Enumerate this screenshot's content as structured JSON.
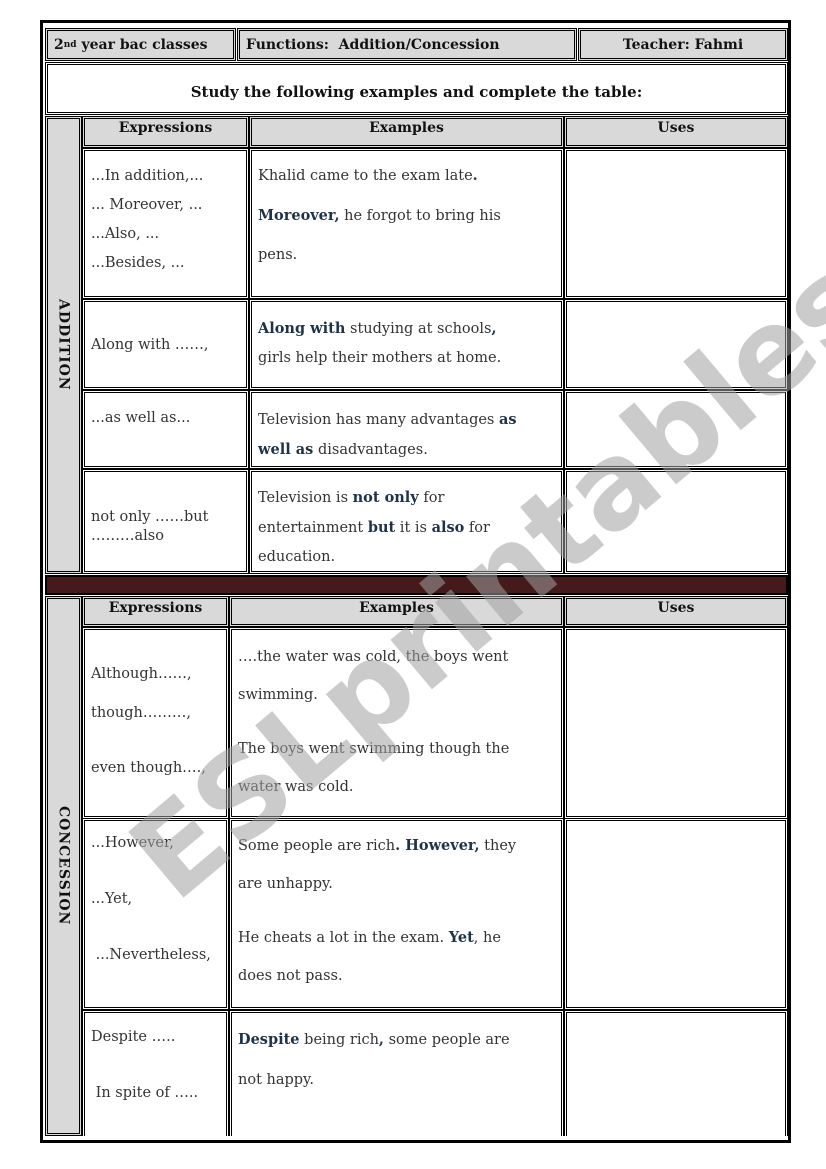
{
  "header": {
    "class_label_prefix": "2",
    "class_label_sup": "nd",
    "class_label_rest": " year bac classes",
    "functions_label": "Functions:  Addition/Concession",
    "teacher_label": "Teacher: Fahmi"
  },
  "instruction": "Study the following examples and complete the table:",
  "columns": {
    "expressions": "Expressions",
    "examples": "Examples",
    "uses": "Uses"
  },
  "addition": {
    "section_label": "ADDITION",
    "rows": [
      {
        "expressions": [
          "...In addition,...",
          "... Moreover, ...",
          "...Also, ...",
          "...Besides, ..."
        ],
        "example": [
          [
            {
              "t": "Khalid came to the exam late",
              "b": false
            },
            {
              "t": ".",
              "b": true
            }
          ],
          [
            {
              "t": "Moreover,",
              "b": true
            },
            {
              "t": " he forgot to bring his",
              "b": false
            }
          ],
          [
            {
              "t": "pens.",
              "b": false
            }
          ]
        ],
        "uses": ""
      },
      {
        "expressions": [
          "Along with ……,"
        ],
        "example": [
          [
            {
              "t": "Along with",
              "b": true
            },
            {
              "t": " studying at schools",
              "b": false
            },
            {
              "t": ",",
              "b": true
            }
          ],
          [
            {
              "t": "girls help their mothers at home.",
              "b": false
            }
          ]
        ],
        "uses": ""
      },
      {
        "expressions": [
          "...as well as..."
        ],
        "example": [
          [
            {
              "t": "Television has many advantages ",
              "b": false
            },
            {
              "t": "as",
              "b": true
            }
          ],
          [
            {
              "t": "well as",
              "b": true
            },
            {
              "t": " disadvantages.",
              "b": false
            }
          ]
        ],
        "uses": ""
      },
      {
        "expressions": [
          "not only ……but",
          "………also"
        ],
        "example": [
          [
            {
              "t": "Television is ",
              "b": false
            },
            {
              "t": "not only",
              "b": true
            },
            {
              "t": " for",
              "b": false
            }
          ],
          [
            {
              "t": "entertainment ",
              "b": false
            },
            {
              "t": "but",
              "b": true
            },
            {
              "t": " it is ",
              "b": false
            },
            {
              "t": "also",
              "b": true
            },
            {
              "t": " for",
              "b": false
            }
          ],
          [
            {
              "t": "education.",
              "b": false
            }
          ]
        ],
        "uses": ""
      }
    ]
  },
  "concession": {
    "section_label": "CONCESSION",
    "rows": [
      {
        "expressions": [
          "Although……,",
          "though………,",
          "even though….,"
        ],
        "example": [
          [
            {
              "t": "….the water was cold, the boys went",
              "b": false
            }
          ],
          [
            {
              "t": "swimming.",
              "b": false
            }
          ],
          [
            {
              "t": "The boys went swimming though the",
              "b": false
            }
          ],
          [
            {
              "t": "water was cold.",
              "b": false
            }
          ]
        ],
        "uses": ""
      },
      {
        "expressions": [
          "...However,",
          "...Yet,",
          " ...Nevertheless,"
        ],
        "example": [
          [
            {
              "t": "Some people are rich",
              "b": false
            },
            {
              "t": ". However,",
              "b": true
            },
            {
              "t": " they",
              "b": false
            }
          ],
          [
            {
              "t": "are unhappy.",
              "b": false
            }
          ],
          [
            {
              "t": "He cheats a lot in the exam. ",
              "b": false
            },
            {
              "t": "Yet",
              "b": true
            },
            {
              "t": ", he",
              "b": false
            }
          ],
          [
            {
              "t": "does not pass.",
              "b": false
            }
          ]
        ],
        "uses": ""
      },
      {
        "expressions": [
          "Despite …..",
          " In spite of ….."
        ],
        "example": [
          [
            {
              "t": "Despite",
              "b": true
            },
            {
              "t": " being rich",
              "b": false
            },
            {
              "t": ",",
              "b": true
            },
            {
              "t": " some people are",
              "b": false
            }
          ],
          [
            {
              "t": "not happy.",
              "b": false
            }
          ]
        ],
        "uses": ""
      }
    ]
  },
  "watermark": "ESLprintables.com",
  "colors": {
    "keyword": "#1f3347",
    "header_bg": "#d9d9d9",
    "separator_band": "#451a1a"
  }
}
